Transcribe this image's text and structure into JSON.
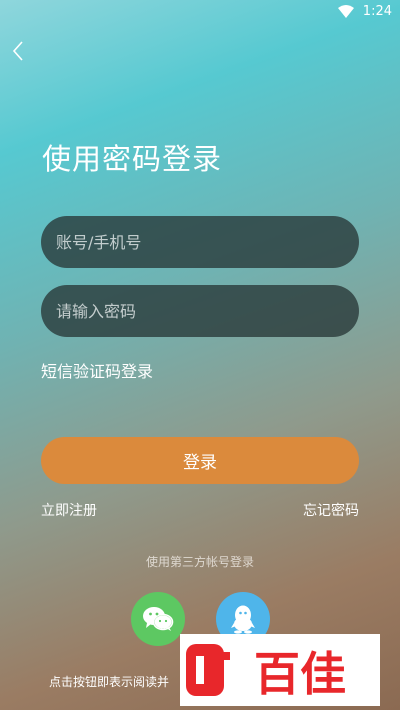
{
  "status_bar": {
    "time": "1:24",
    "wifi_icon": "wifi-icon"
  },
  "header": {
    "back_icon": "chevron-left-icon",
    "title": "使用密码登录"
  },
  "form": {
    "account_placeholder": "账号/手机号",
    "account_value": "",
    "password_placeholder": "请输入密码",
    "password_value": "",
    "sms_login_label": "短信验证码登录",
    "login_label": "登录",
    "register_label": "立即注册",
    "forgot_label": "忘记密码"
  },
  "third_party": {
    "label": "使用第三方帐号登录",
    "providers": [
      {
        "name": "wechat",
        "icon": "wechat-icon",
        "color": "#5dc862"
      },
      {
        "name": "qq",
        "icon": "qq-icon",
        "color": "#4fb5ea"
      }
    ]
  },
  "agreement": {
    "text": "点击按钮即表示阅读并"
  },
  "watermark": {
    "icon": "baijia-logo",
    "text": "百佳",
    "color": "#e8272b"
  },
  "colors": {
    "accent": "#db8a3c",
    "field_bg": "#37494a"
  }
}
